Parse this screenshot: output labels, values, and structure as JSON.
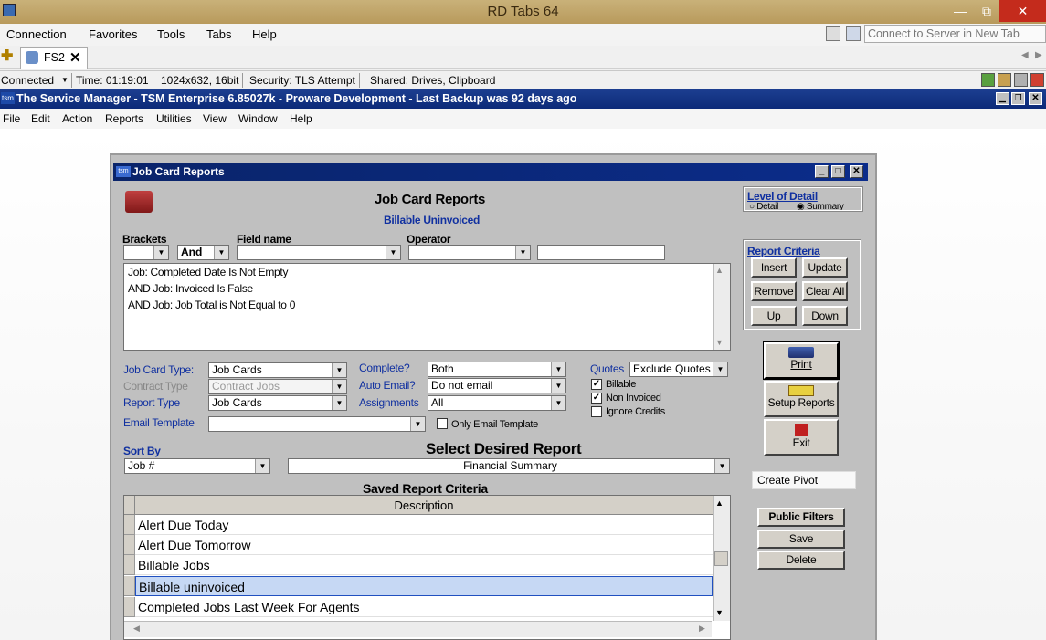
{
  "rd": {
    "title": "RD Tabs 64",
    "minimize": "—",
    "restore": "⧉",
    "close": "✕",
    "menu": [
      "Connection",
      "Favorites",
      "Tools",
      "Tabs",
      "Help"
    ],
    "tab_label": "FS2",
    "connect_placeholder": "Connect to Server in New Tab",
    "status": {
      "connected": "Connected",
      "time": "Time: 01:19:01",
      "resolution": "1024x632, 16bit",
      "security": "Security: TLS Attempt",
      "shared": "Shared: Drives, Clipboard"
    }
  },
  "tsm": {
    "title": "The Service Manager - TSM Enterprise 6.85027k - Proware Development - Last Backup was 92 days ago",
    "menu": [
      "File",
      "Edit",
      "Action",
      "Reports",
      "Utilities",
      "View",
      "Window",
      "Help"
    ]
  },
  "dialog": {
    "title": "Job Card Reports",
    "heading": "Job Card Reports",
    "subheading": "Billable Uninvoiced",
    "level_of_detail": {
      "label": "Level of Detail",
      "options": [
        "Detail",
        "Summary"
      ],
      "selected": "Summary"
    },
    "filter": {
      "brackets_label": "Brackets",
      "andor_label": "And",
      "field_label": "Field name",
      "operator_label": "Operator",
      "criteria": [
        "Job: Completed Date Is Not Empty",
        "AND Job: Invoiced Is False",
        "AND Job: Job Total is Not Equal to 0"
      ]
    },
    "report_criteria": {
      "label": "Report Criteria",
      "insert": "Insert",
      "update": "Update",
      "remove": "Remove",
      "clear_all": "Clear All",
      "up": "Up",
      "down": "Down"
    },
    "fields": {
      "job_card_type_label": "Job Card Type:",
      "job_card_type": "Job Cards",
      "contract_type_label": "Contract Type",
      "contract_type": "Contract Jobs",
      "report_type_label": "Report Type",
      "report_type": "Job Cards",
      "email_template_label": "Email Template",
      "email_template": "",
      "complete_label": "Complete?",
      "complete": "Both",
      "auto_email_label": "Auto Email?",
      "auto_email": "Do not email",
      "assignments_label": "Assignments",
      "assignments": "All",
      "only_email_template": "Only Email Template",
      "quotes_label": "Quotes",
      "quotes": "Exclude Quotes",
      "billable": "Billable",
      "non_invoiced": "Non Invoiced",
      "ignore_credits": "Ignore Credits"
    },
    "actions": {
      "print": "Print",
      "setup_reports": "Setup Reports",
      "exit": "Exit"
    },
    "sort_by_label": "Sort By",
    "sort_by": "Job #",
    "select_report_label": "Select Desired Report",
    "select_report": "Financial Summary",
    "create_pivot": "Create Pivot",
    "saved": {
      "label": "Saved Report Criteria",
      "column": "Description",
      "rows": [
        "Alert Due Today",
        "Alert Due Tomorrow",
        "Billable Jobs",
        "Billable uninvoiced",
        "Completed Jobs Last Week For Agents"
      ],
      "selected_index": 3
    },
    "public_filters": "Public Filters",
    "save": "Save",
    "delete": "Delete"
  }
}
